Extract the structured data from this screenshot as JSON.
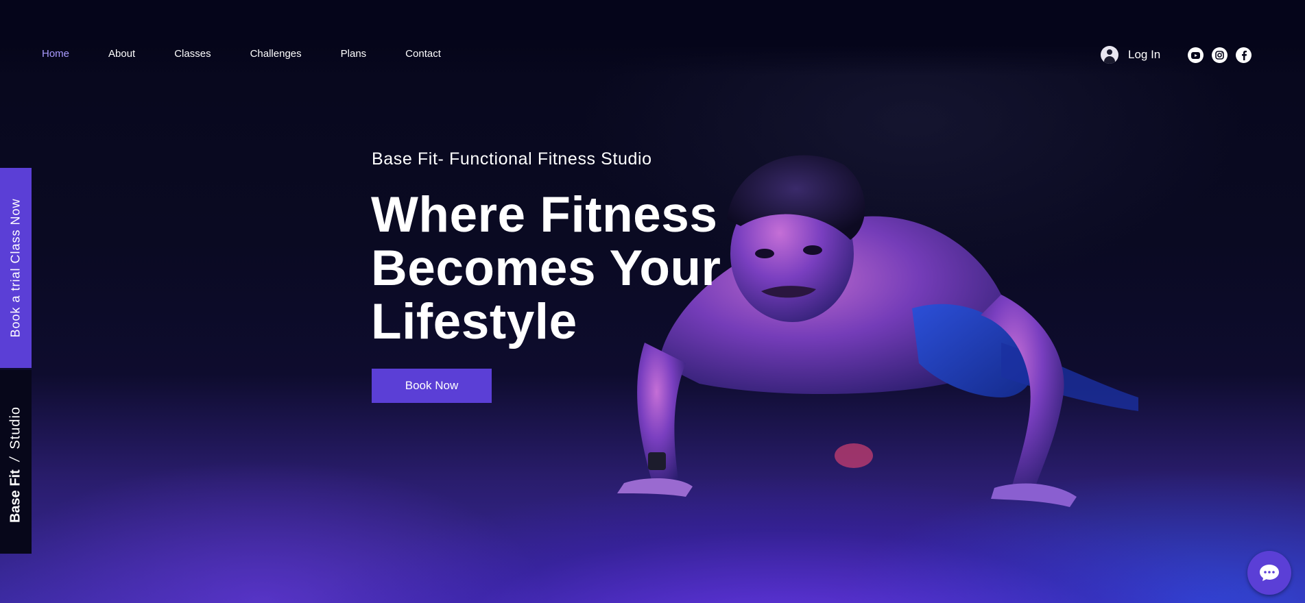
{
  "nav": {
    "items": [
      {
        "label": "Home",
        "active": true
      },
      {
        "label": "About"
      },
      {
        "label": "Classes"
      },
      {
        "label": "Challenges"
      },
      {
        "label": "Plans"
      },
      {
        "label": "Contact"
      }
    ]
  },
  "header": {
    "login_label": "Log In",
    "social": [
      "youtube-icon",
      "instagram-icon",
      "facebook-icon"
    ]
  },
  "side": {
    "trial_label": "Book a trial Class Now",
    "brand_strong": "Base Fit",
    "brand_slash": "/",
    "brand_light": "Studio"
  },
  "hero": {
    "subtitle": "Base Fit- Functional Fitness Studio",
    "title_lines": [
      "Where Fitness",
      "Becomes Your",
      "Lifestyle"
    ],
    "button_label": "Book Now"
  },
  "colors": {
    "accent": "#5b3fd6",
    "active_nav": "#a99bff",
    "background": "#05051a"
  }
}
